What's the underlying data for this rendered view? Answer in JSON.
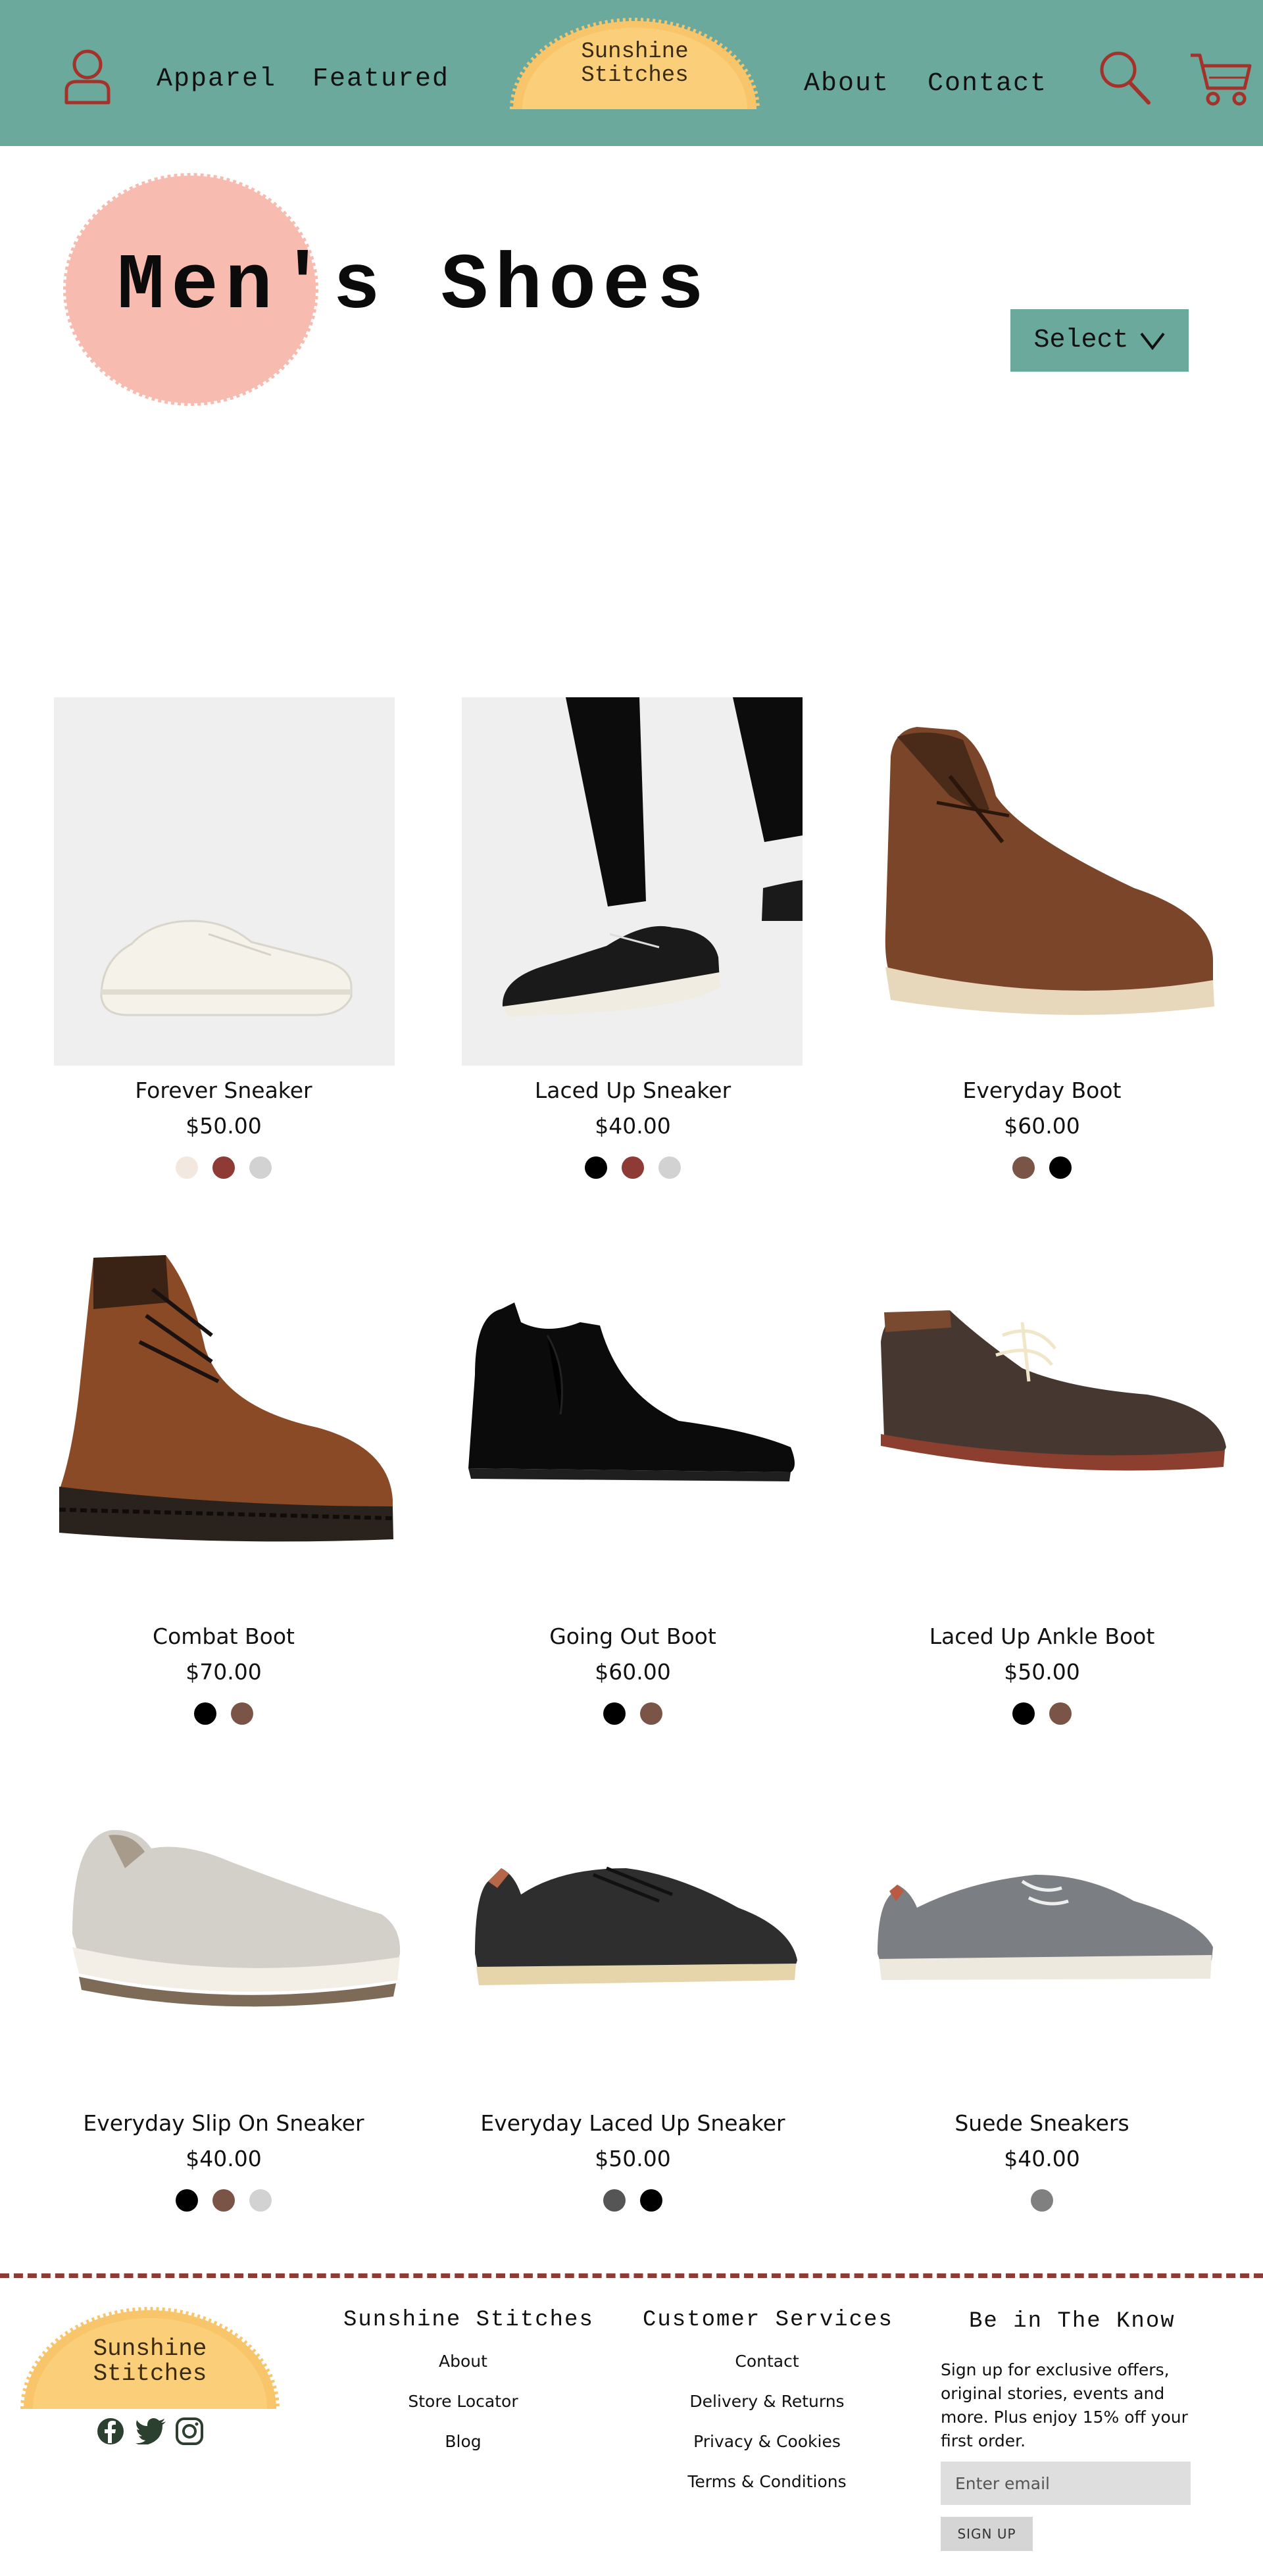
{
  "header": {
    "nav_left": [
      "Apparel",
      "Featured"
    ],
    "nav_right": [
      "About",
      "Contact"
    ],
    "logo_line1": "Sunshine",
    "logo_line2": "Stitches",
    "bar_color": "#6aa99c",
    "icon_color": "#a3322b"
  },
  "hero": {
    "title": "Men's Shoes",
    "select_label": "Select",
    "circle_color": "#f7bbb0"
  },
  "products": [
    {
      "name": "Forever Sneaker",
      "price": "$50.00",
      "swatches": [
        "#f3e8df",
        "#8e3a35",
        "#d2d2d2"
      ]
    },
    {
      "name": "Laced Up Sneaker",
      "price": "$40.00",
      "swatches": [
        "#000000",
        "#8e3a35",
        "#d2d2d2"
      ]
    },
    {
      "name": "Everyday Boot",
      "price": "$60.00",
      "swatches": [
        "#7a5446",
        "#000000"
      ]
    },
    {
      "name": "Combat Boot",
      "price": "$70.00",
      "swatches": [
        "#000000",
        "#7a5446"
      ]
    },
    {
      "name": "Going Out Boot",
      "price": "$60.00",
      "swatches": [
        "#000000",
        "#7a5446"
      ]
    },
    {
      "name": "Laced Up Ankle Boot",
      "price": "$50.00",
      "swatches": [
        "#000000",
        "#7a5446"
      ]
    },
    {
      "name": "Everyday Slip On Sneaker",
      "price": "$40.00",
      "swatches": [
        "#000000",
        "#7a5446",
        "#d2d2d2"
      ]
    },
    {
      "name": "Everyday Laced Up Sneaker",
      "price": "$50.00",
      "swatches": [
        "#555555",
        "#000000"
      ]
    },
    {
      "name": "Suede Sneakers",
      "price": "$40.00",
      "swatches": [
        "#808080"
      ]
    }
  ],
  "footer": {
    "logo_line1": "Sunshine",
    "logo_line2": "Stitches",
    "col1_title": "Sunshine Stitches",
    "col1_links": [
      "About",
      "Store Locator",
      "Blog"
    ],
    "col2_title": "Customer Services",
    "col2_links": [
      "Contact",
      "Delivery & Returns",
      "Privacy & Cookies",
      "Terms & Conditions"
    ],
    "col3_title": "Be in The Know",
    "signup_text": "Sign up for exclusive offers, original stories, events and more. Plus enjoy 15% off your first order.",
    "email_placeholder": "Enter email",
    "signup_button": "SIGN UP",
    "social_icons": [
      "facebook-icon",
      "twitter-icon",
      "instagram-icon"
    ],
    "divider_color": "#8e3a35"
  }
}
